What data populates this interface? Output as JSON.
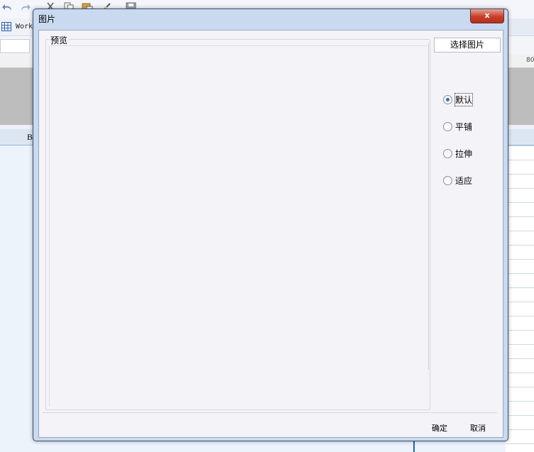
{
  "background": {
    "tab_label": "Work",
    "ruler_number": "80",
    "column_header": "B"
  },
  "dialog": {
    "title": "图片",
    "close_glyph": "x",
    "preview_label": "预览",
    "select_button": "选择图片",
    "options": [
      {
        "label": "默认",
        "checked": true
      },
      {
        "label": "平铺",
        "checked": false
      },
      {
        "label": "拉伸",
        "checked": false
      },
      {
        "label": "适应",
        "checked": false
      }
    ],
    "ok_label": "确定",
    "cancel_label": "取消"
  },
  "colors": {
    "dialog_frame": "#c9daf0",
    "client_bg": "#f4f3f8",
    "close_button": "#c7402a",
    "radio_accent": "#3c6fb0"
  }
}
